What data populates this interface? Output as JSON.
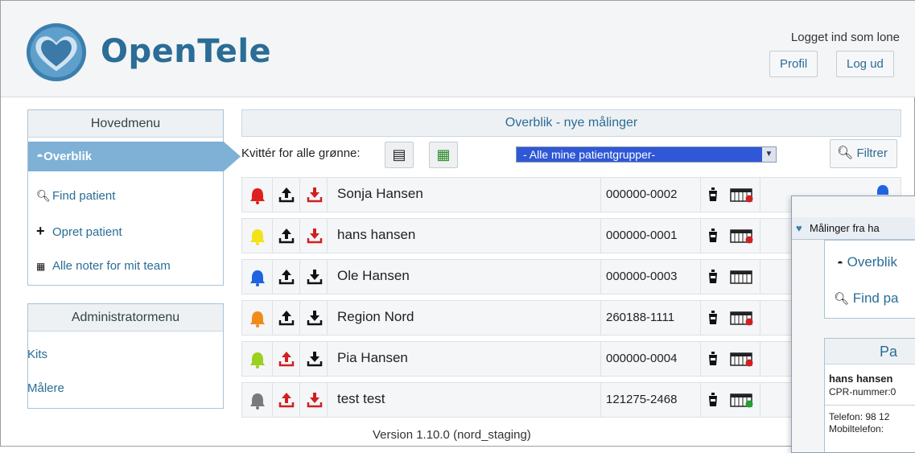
{
  "app": {
    "name": "OpenTele"
  },
  "header": {
    "logged_in_text": "Logget ind som lone",
    "profile_label": "Profil",
    "logout_label": "Log ud"
  },
  "main_menu": {
    "title": "Hovedmenu",
    "items": [
      {
        "label": "Overblik",
        "icon": "cup-icon",
        "active": true
      },
      {
        "label": "Find patient",
        "icon": "search-icon"
      },
      {
        "label": "Opret patient",
        "icon": "plus-icon"
      },
      {
        "label": "Alle noter for mit team",
        "icon": "notes-icon"
      }
    ]
  },
  "admin_menu": {
    "title": "Administratormenu",
    "items": [
      {
        "label": "Kits"
      },
      {
        "label": "Målere"
      }
    ]
  },
  "overview": {
    "title": "Overblik - nye målinger",
    "acknowledge_label": "Kvittér for alle grønne:",
    "group_select_value": "- Alle mine patientgrupper-",
    "filter_label": "Filtrer"
  },
  "patients": [
    {
      "name": "Sonja Hansen",
      "cpr": "000000-0002",
      "bell_color": "#e02020",
      "up_color": "#111111",
      "down_color": "#d02020",
      "cal_status": "red"
    },
    {
      "name": "hans hansen",
      "cpr": "000000-0001",
      "bell_color": "#f2e21a",
      "up_color": "#111111",
      "down_color": "#d02020",
      "cal_status": "red"
    },
    {
      "name": "Ole Hansen",
      "cpr": "000000-0003",
      "bell_color": "#1f63e0",
      "up_color": "#111111",
      "down_color": "#111111",
      "cal_status": "none"
    },
    {
      "name": "Region Nord",
      "cpr": "260188-1111",
      "bell_color": "#f08a1a",
      "up_color": "#111111",
      "down_color": "#111111",
      "cal_status": "red"
    },
    {
      "name": "Pia Hansen",
      "cpr": "000000-0004",
      "bell_color": "#9ad01e",
      "up_color": "#d02020",
      "down_color": "#111111",
      "cal_status": "red"
    },
    {
      "name": "test test",
      "cpr": "121275-2468",
      "bell_color": "#7a7a7a",
      "up_color": "#d02020",
      "down_color": "#d02020",
      "cal_status": "green"
    }
  ],
  "footer": {
    "version": "Version 1.10.0 (nord_staging)"
  },
  "popup": {
    "title": "Målinger fra ha",
    "menu_items": [
      "Overblik",
      "Find pa"
    ],
    "panel_title": "Pa",
    "patient_name": "hans hansen",
    "cpr_line": "CPR-nummer:0",
    "phone_line": "Telefon: 98 12",
    "mobile_line": "Mobiltelefon:"
  },
  "colors": {
    "brand": "#2a6d96",
    "active_menu": "#7fb0d6",
    "select_bg": "#2f57d6"
  }
}
